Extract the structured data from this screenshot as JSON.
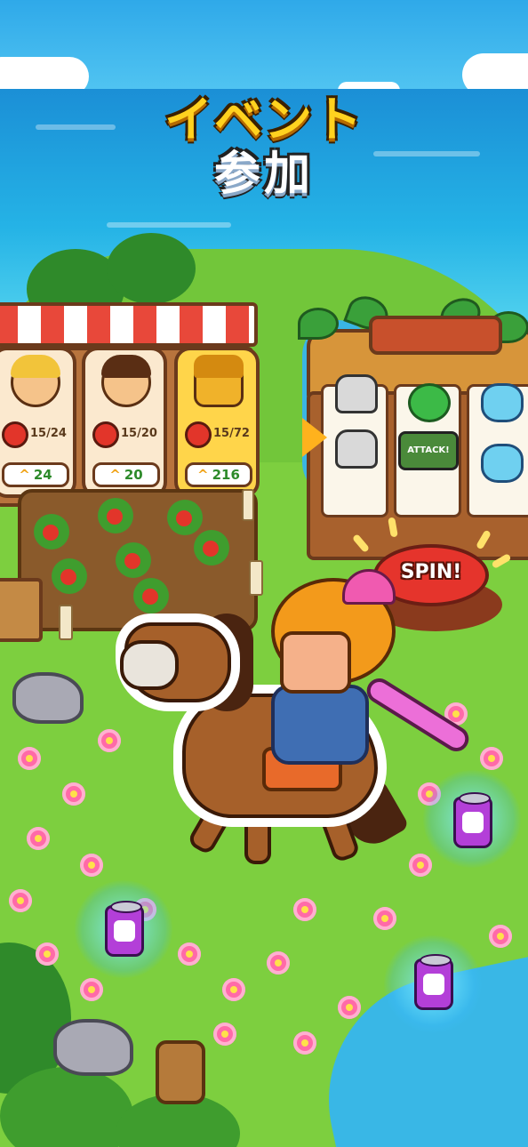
{
  "title": {
    "line1": "イベント",
    "line2": "参加"
  },
  "market": {
    "cards": [
      {
        "character": "blonde-villager",
        "tomato_count": "15/24",
        "reward": "24"
      },
      {
        "character": "brunette-villager",
        "tomato_count": "15/20",
        "reward": "20"
      },
      {
        "character": "golden-idol",
        "tomato_count": "15/72",
        "reward": "216"
      }
    ],
    "reward_icon": "chevron-up-icon",
    "item_icon": "tomato-icon"
  },
  "slot_machine": {
    "reel_symbols": [
      "skull-icon",
      "skull-icon",
      "gem-icon",
      "attack-icon",
      "butterfly-icon",
      "butterfly-icon"
    ],
    "attack_label": "ATTACK!",
    "spin_label": "SPIN!"
  },
  "colors": {
    "title_yellow": "#ffd21f",
    "spin_red": "#e5342c",
    "reward_green": "#2d8a2a",
    "can_purple": "#b33fd8"
  }
}
